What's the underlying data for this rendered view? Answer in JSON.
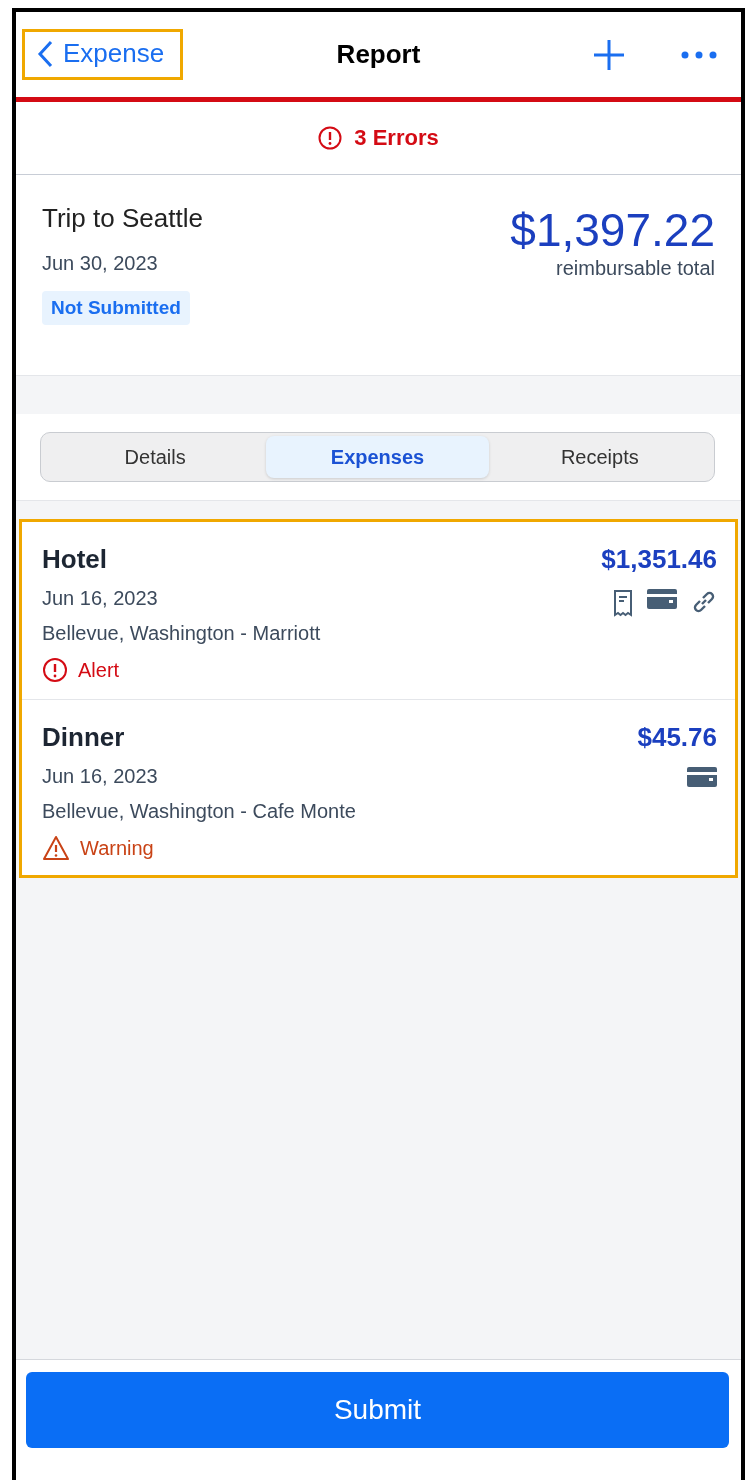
{
  "nav": {
    "back_label": "Expense",
    "back_highlighted": true,
    "title": "Report"
  },
  "errors": {
    "label": "3 Errors"
  },
  "report": {
    "name": "Trip to Seattle",
    "date": "Jun 30, 2023",
    "status": "Not Submitted",
    "amount": "$1,397.22",
    "amount_caption": "reimbursable total"
  },
  "tabs": [
    {
      "label": "Details",
      "selected": false
    },
    {
      "label": "Expenses",
      "selected": true
    },
    {
      "label": "Receipts",
      "selected": false
    }
  ],
  "expenses_highlighted": true,
  "expenses": [
    {
      "type": "Hotel",
      "amount": "$1,351.46",
      "date": "Jun 16, 2023",
      "location": "Bellevue, Washington - Marriott",
      "icons": [
        {
          "kind": "receipt"
        },
        {
          "kind": "card"
        },
        {
          "kind": "link"
        }
      ],
      "status": {
        "kind": "alert",
        "label": "Alert"
      }
    },
    {
      "type": "Dinner",
      "amount": "$45.76",
      "date": "Jun 16, 2023",
      "location": "Bellevue, Washington - Cafe Monte",
      "icons": [
        {
          "kind": "card"
        }
      ],
      "status": {
        "kind": "warning",
        "label": "Warning"
      }
    }
  ],
  "submit_label": "Submit"
}
